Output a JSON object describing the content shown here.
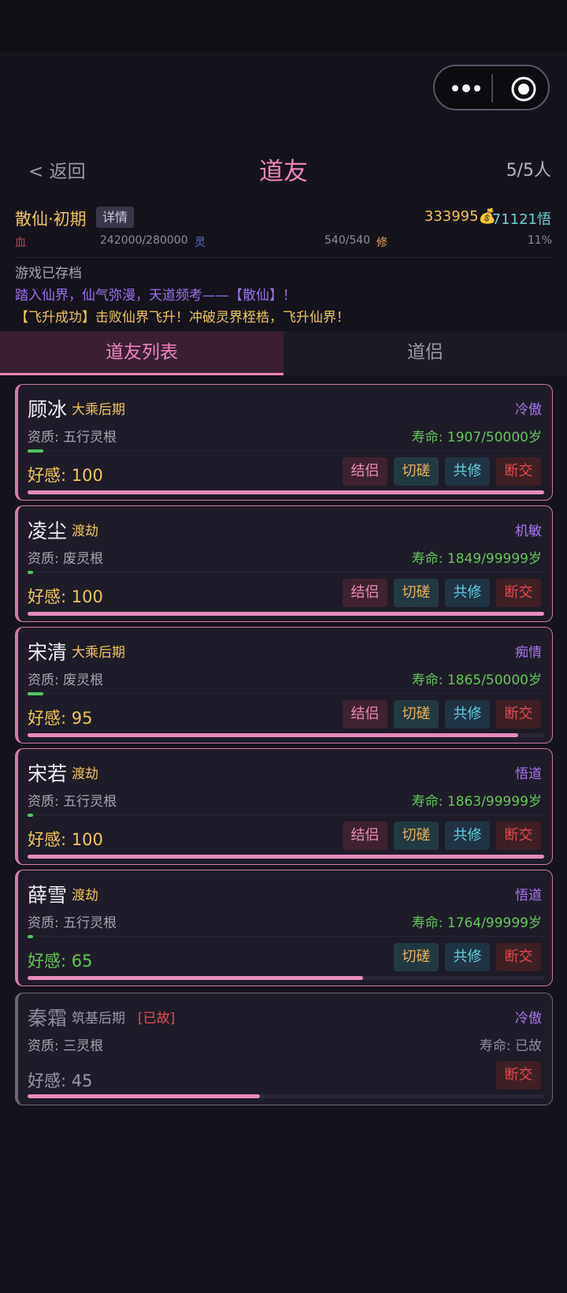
{
  "header": {
    "back_label": "< 返回",
    "title": "道友",
    "count": "5/5人"
  },
  "player": {
    "realm": "散仙·初期",
    "detail_label": "详情",
    "spirit_stones": "333995💰",
    "insight": "71121悟",
    "blood_label": "血",
    "hp": "242000/280000",
    "ling_label": "灵",
    "mp": "540/540",
    "xiu_label": "修",
    "cultivation_pct": "11%"
  },
  "log": [
    "游戏已存档",
    "踏入仙界，仙气弥漫，天道频考——【散仙】！",
    "【飞升成功】击败仙界飞升！冲破灵界桎梏，飞升仙界！"
  ],
  "tabs": [
    "道友列表",
    "道侣"
  ],
  "buttons": {
    "marry": "结侣",
    "spar": "切磋",
    "cocultivate": "共修",
    "break": "断交"
  },
  "friends": [
    {
      "name": "顾冰",
      "realm": "大乘后期",
      "personality": "冷傲",
      "qualification": "资质: 五行灵根",
      "lifespan": "寿命: 1907/50000岁",
      "affection_label": "好感: 100",
      "affection": 100,
      "hp_fraction": 0.03
    },
    {
      "name": "凌尘",
      "realm": "渡劫",
      "personality": "机敏",
      "qualification": "资质: 废灵根",
      "lifespan": "寿命: 1849/99999岁",
      "affection_label": "好感: 100",
      "affection": 100,
      "hp_fraction": 0.01
    },
    {
      "name": "宋清",
      "realm": "大乘后期",
      "personality": "痴情",
      "qualification": "资质: 废灵根",
      "lifespan": "寿命: 1865/50000岁",
      "affection_label": "好感: 95",
      "affection": 95,
      "hp_fraction": 0.03
    },
    {
      "name": "宋若",
      "realm": "渡劫",
      "personality": "悟道",
      "qualification": "资质: 五行灵根",
      "lifespan": "寿命: 1863/99999岁",
      "affection_label": "好感: 100",
      "affection": 100,
      "hp_fraction": 0.01
    },
    {
      "name": "薛雪",
      "realm": "渡劫",
      "personality": "悟道",
      "qualification": "资质: 五行灵根",
      "lifespan": "寿命: 1764/99999岁",
      "affection_label": "好感: 65",
      "affection": 65,
      "hp_fraction": 0.01
    },
    {
      "name": "秦霜",
      "realm": "筑基后期",
      "dead_tag": "[已故]",
      "personality": "冷傲",
      "qualification": "资质: 三灵根",
      "lifespan": "寿命: 已故",
      "affection_label": "好感: 45",
      "affection": 45
    }
  ]
}
